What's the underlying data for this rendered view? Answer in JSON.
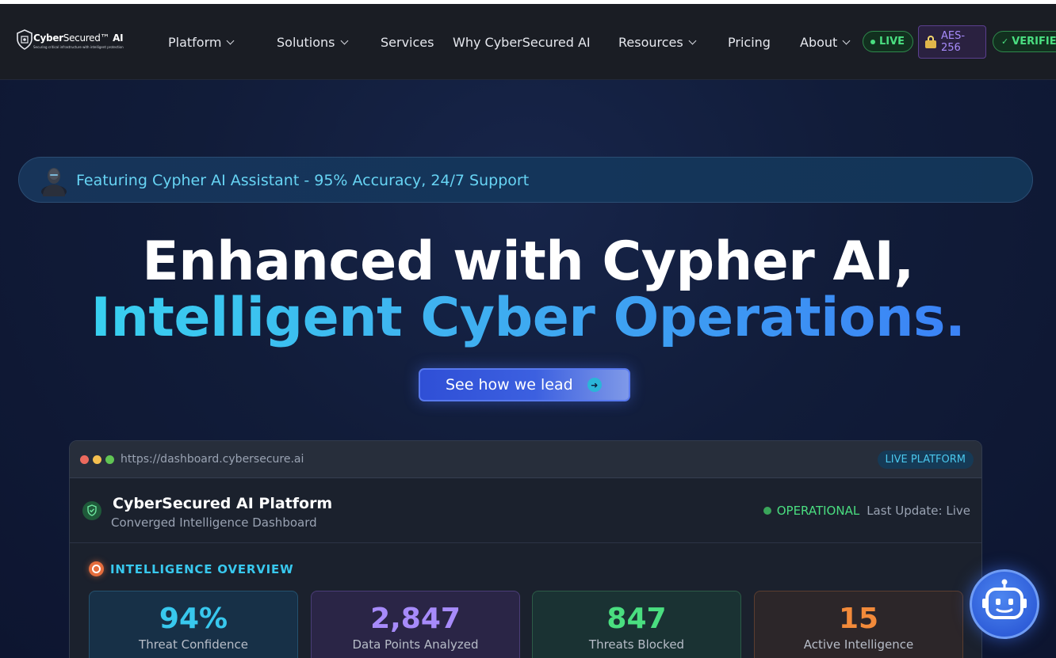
{
  "brand": {
    "name_bold": "Cyber",
    "name_thin": "Secured™",
    "name_ai": "AI",
    "tagline": "Securing critical infrastructure with intelligent protection"
  },
  "nav": {
    "items": [
      {
        "label": "Platform",
        "dropdown": true
      },
      {
        "label": "Solutions",
        "dropdown": true
      },
      {
        "label": "Services",
        "dropdown": false
      },
      {
        "label": "Why CyberSecured AI",
        "dropdown": false
      },
      {
        "label": "Resources",
        "dropdown": true
      },
      {
        "label": "Pricing",
        "dropdown": false
      },
      {
        "label": "About",
        "dropdown": true
      }
    ],
    "live_badge": "LIVE",
    "aes_badge": "AES-256",
    "verified_badge": "VERIFIED"
  },
  "announcement": {
    "text": "Featuring Cypher AI Assistant - 95% Accuracy, 24/7 Support"
  },
  "hero": {
    "line1": "Enhanced with Cypher AI,",
    "line2": "Intelligent Cyber Operations.",
    "cta_label": "See how we lead"
  },
  "dashboard": {
    "url": "https://dashboard.cybersecure.ai",
    "live_label": "LIVE PLATFORM",
    "title": "CyberSecured AI Platform",
    "subtitle": "Converged Intelligence Dashboard",
    "status": "OPERATIONAL",
    "last_update": "Last Update: Live",
    "overview_label": "INTELLIGENCE OVERVIEW",
    "stats": [
      {
        "value": "94%",
        "label": "Threat Confidence",
        "color": "#38c8ee"
      },
      {
        "value": "2,847",
        "label": "Data Points Analyzed",
        "color": "#a78bfa"
      },
      {
        "value": "847",
        "label": "Threats Blocked",
        "color": "#4ade80"
      },
      {
        "value": "15",
        "label": "Active Intelligence",
        "color": "#f28a3a"
      }
    ]
  },
  "colors": {
    "accent": "#38c8ee",
    "success": "#4ade80",
    "purple": "#a78bfa",
    "orange": "#f28a3a",
    "cta": "#3c60e0"
  }
}
